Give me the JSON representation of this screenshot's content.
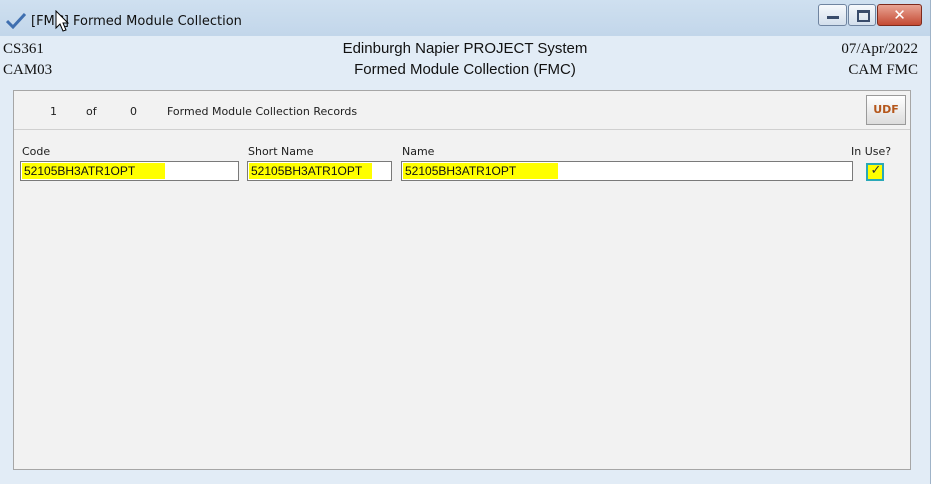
{
  "window": {
    "title": "[FMC] Formed Module Collection",
    "close_glyph": "✕"
  },
  "header": {
    "left_line1": "CS361",
    "left_line2": "CAM03",
    "center_line1": "Edinburgh Napier PROJECT System",
    "center_line2": "Formed Module Collection (FMC)",
    "right_line1": "07/Apr/2022",
    "right_line2": "CAM  FMC"
  },
  "records": {
    "current": "1",
    "of_label": "of",
    "total": "0",
    "label": "Formed Module Collection Records",
    "udf_button": "UDF"
  },
  "form": {
    "code": {
      "label": "Code",
      "value": "52105BH3ATR1OPT"
    },
    "short_name": {
      "label": "Short Name",
      "value": "52105BH3ATR1OPT"
    },
    "name": {
      "label": "Name",
      "value": "52105BH3ATR1OPT"
    },
    "in_use": {
      "label": "In Use?",
      "checked": true,
      "check_glyph": "✓"
    }
  },
  "colors": {
    "highlight": "#ffff00",
    "checkbox_border": "#2aa8b8",
    "window_bg": "#e2ecf6"
  },
  "icons": {
    "app": "checkmark-app-icon",
    "cursor": "mouse-pointer-icon"
  }
}
